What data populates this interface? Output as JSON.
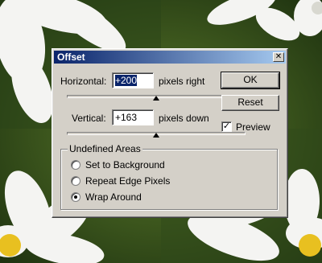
{
  "dialog": {
    "title": "Offset",
    "close_glyph": "✕",
    "horizontal": {
      "label": "Horizontal:",
      "value": "+200",
      "unit": "pixels right",
      "slider_level": 0.5
    },
    "vertical": {
      "label": "Vertical:",
      "value": "+163",
      "unit": "pixels down",
      "slider_level": 0.5
    },
    "buttons": {
      "ok": "OK",
      "reset": "Reset"
    },
    "preview": {
      "label": "Preview",
      "checked": true,
      "check_glyph": "✓"
    },
    "undefined_areas": {
      "title": "Undefined Areas",
      "options": [
        {
          "label": "Set to Background",
          "selected": false
        },
        {
          "label": "Repeat Edge Pixels",
          "selected": false
        },
        {
          "label": "Wrap Around",
          "selected": true
        }
      ]
    }
  },
  "colors": {
    "dialog_face": "#d4d0c8",
    "titlebar_start": "#0a246a",
    "titlebar_end": "#a6caf0",
    "selection": "#0a246a"
  }
}
